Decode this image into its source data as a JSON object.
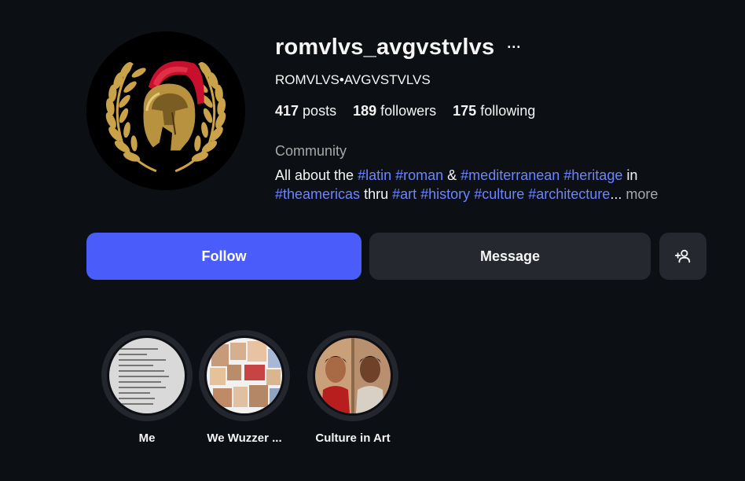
{
  "profile": {
    "username": "romvlvs_avgvstvlvs",
    "more_options": "···",
    "full_name": "ROMVLVS•AVGVSTVLVS",
    "stats": {
      "posts_count": "417",
      "posts_label": "posts",
      "followers_count": "189",
      "followers_label": "followers",
      "following_count": "175",
      "following_label": "following"
    },
    "category": "Community",
    "bio": {
      "t1": "All about the ",
      "h1": "#latin",
      "t2": " ",
      "h2": "#roman",
      "t3": " & ",
      "h3": "#mediterranean",
      "t4": " ",
      "h4": "#heritage",
      "t5": " in",
      "h5": "#theamericas",
      "t6": " thru ",
      "h6": "#art",
      "t7": " ",
      "h7": "#history",
      "t8": " ",
      "h8": "#culture",
      "t9": " ",
      "h9": "#architecture",
      "t10": "...",
      "more": " more"
    }
  },
  "actions": {
    "follow_label": "Follow",
    "message_label": "Message",
    "add_user_icon": "person-add-icon"
  },
  "highlights": [
    {
      "label": "Me"
    },
    {
      "label": "We Wuzzer ..."
    },
    {
      "label": "Culture in Art"
    }
  ],
  "colors": {
    "background": "#0c0f14",
    "accent": "#4a5dfa",
    "hashtag": "#6b85ff",
    "secondary_text": "#a8a8a8",
    "button_dark": "#25282e"
  }
}
